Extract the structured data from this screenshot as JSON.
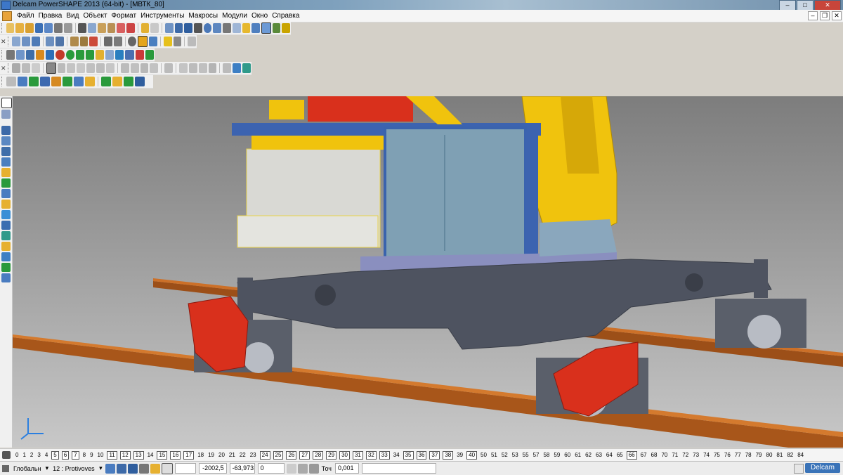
{
  "title_bar": {
    "text": "Delcam PowerSHAPE 2013 (64-bit) - [МВТК_80]"
  },
  "menu": [
    "Файл",
    "Правка",
    "Вид",
    "Объект",
    "Формат",
    "Инструменты",
    "Макросы",
    "Модули",
    "Окно",
    "Справка"
  ],
  "levels": {
    "visible": [
      "0",
      "1",
      "2",
      "3",
      "4",
      "5",
      "6",
      "7",
      "8",
      "9",
      "10",
      "11",
      "12",
      "13",
      "14",
      "15",
      "16",
      "17",
      "18",
      "19",
      "20",
      "21",
      "22",
      "23",
      "24",
      "25",
      "26",
      "27",
      "28",
      "29",
      "30",
      "31",
      "32",
      "33",
      "34",
      "35",
      "36",
      "37",
      "38",
      "39",
      "40",
      "50",
      "51",
      "52",
      "53",
      "55",
      "57",
      "58",
      "59",
      "60",
      "61",
      "62",
      "63",
      "64",
      "65",
      "66",
      "67",
      "68",
      "70",
      "71",
      "72",
      "73",
      "74",
      "75",
      "76",
      "77",
      "78",
      "79",
      "80",
      "81",
      "82",
      "84"
    ],
    "boxed": [
      "5",
      "6",
      "7",
      "11",
      "12",
      "13",
      "15",
      "16",
      "17",
      "24",
      "25",
      "26",
      "27",
      "28",
      "29",
      "30",
      "31",
      "32",
      "33",
      "35",
      "36",
      "37",
      "38",
      "40",
      "66"
    ]
  },
  "statusbar": {
    "workplane": "Глобальн",
    "level_selector": "12 : Protivoves",
    "coord_x": "-2002,5",
    "coord_y": "-63,973",
    "coord_z": "0",
    "tolerance_label": "Точ",
    "tolerance": "0,001",
    "brand": "Delcam"
  },
  "colors": {
    "titlebar": "#6f8fab",
    "accent_red": "#d9301c",
    "crane_yellow": "#f0c30d",
    "frame_gray": "#4e5360",
    "rail_brown": "#a8561a",
    "cabinet": "#7fa0b4"
  }
}
